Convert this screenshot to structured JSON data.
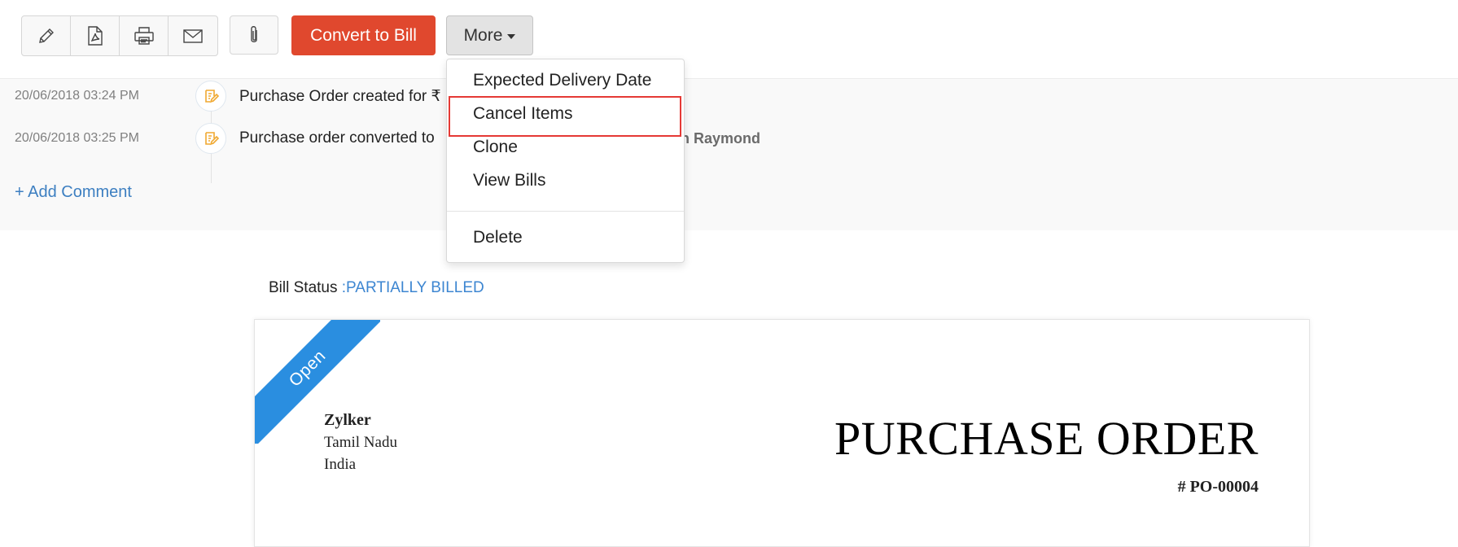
{
  "toolbar": {
    "icons": [
      "pencil-icon",
      "pdf-icon",
      "print-icon",
      "mail-icon",
      "paperclip-icon"
    ],
    "convert_label": "Convert to Bill",
    "more_label": "More",
    "accent_color": "#e0482e"
  },
  "history": {
    "entries": [
      {
        "time": "20/06/2018 03:24 PM",
        "text": "Purchase Order created for ₹"
      },
      {
        "time": "20/06/2018 03:25 PM",
        "text": "Purchase order converted to",
        "user": "en Raymond"
      }
    ],
    "add_comment": "+ Add Comment"
  },
  "more_menu": {
    "items": [
      "Expected Delivery Date",
      "Cancel Items",
      "Clone",
      "View Bills"
    ],
    "danger_item": "Delete",
    "highlighted_item": "Cancel Items"
  },
  "bill_status": {
    "label": "Bill Status",
    "value": ":PARTIALLY BILLED",
    "value_color": "#3d86d1"
  },
  "document": {
    "ribbon": "Open",
    "ribbon_color": "#2a8ee0",
    "org_name": "Zylker",
    "org_state": "Tamil Nadu",
    "org_country": "India",
    "title": "PURCHASE ORDER",
    "number": "# PO-00004"
  }
}
